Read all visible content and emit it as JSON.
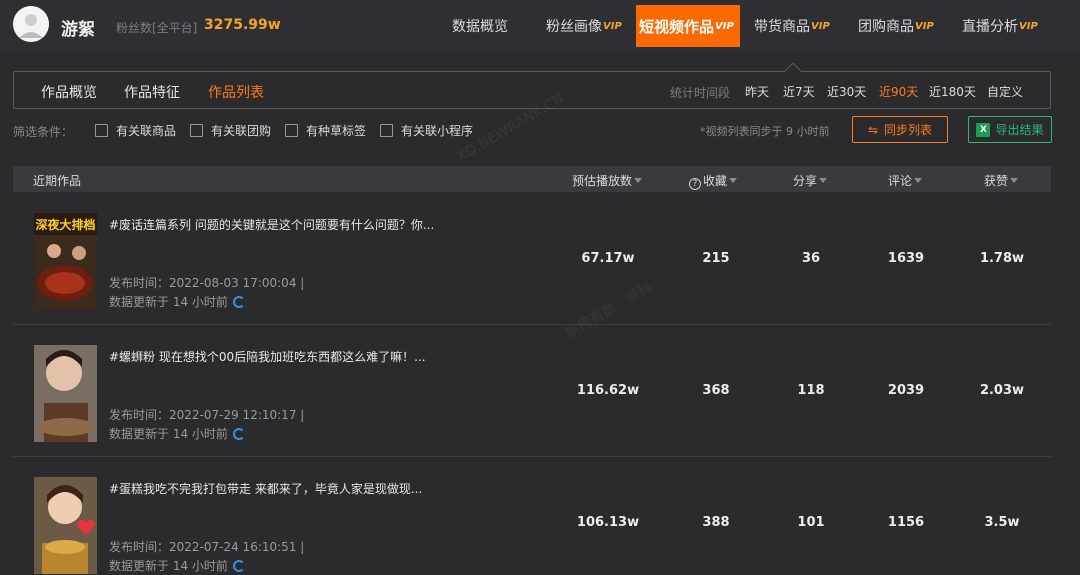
{
  "header": {
    "account_name": "游絮",
    "fans_label": "粉丝数[全平台]",
    "fans_value": "3275.99w",
    "nav": [
      {
        "label": "数据概览",
        "vip": ""
      },
      {
        "label": "粉丝画像",
        "vip": "VIP"
      },
      {
        "label": "短视频作品",
        "vip": "VIP"
      },
      {
        "label": "带货商品",
        "vip": "VIP"
      },
      {
        "label": "团购商品",
        "vip": "VIP"
      },
      {
        "label": "直播分析",
        "vip": "VIP"
      }
    ],
    "active_nav": 2
  },
  "subtabs": {
    "items": [
      "作品概览",
      "作品特征",
      "作品列表"
    ],
    "active": 2,
    "stat_label": "统计时间段",
    "periods": [
      "昨天",
      "近7天",
      "近30天",
      "近90天",
      "近180天",
      "自定义"
    ],
    "active_period": 3
  },
  "filters": {
    "label": "筛选条件：",
    "options": [
      "有关联商品",
      "有关联团购",
      "有种草标签",
      "有关联小程序"
    ],
    "sync_note": "*视频列表同步于 9 小时前",
    "sync_button": "同步列表",
    "export_button": "导出结果"
  },
  "table": {
    "columns": [
      "近期作品",
      "预估播放数",
      "收藏",
      "分享",
      "评论",
      "获赞"
    ],
    "rows": [
      {
        "thumb_text": "深夜大排档",
        "title": "#废话连篇系列 问题的关键就是这个问题要有什么问题？你...",
        "published": "发布时间：2022-08-03 17:00:04 |",
        "updated": "数据更新于 14 小时前",
        "plays": "67.17w",
        "favorites": "215",
        "shares": "36",
        "comments": "1639",
        "likes": "1.78w"
      },
      {
        "thumb_text": "",
        "title": "#螺蛳粉 现在想找个00后陪我加班吃东西都这么难了嘛！...",
        "published": "发布时间：2022-07-29 12:10:17 |",
        "updated": "数据更新于 14 小时前",
        "plays": "116.62w",
        "favorites": "368",
        "shares": "118",
        "comments": "2039",
        "likes": "2.03w"
      },
      {
        "thumb_text": "",
        "title": "#蛋糕我吃不完我打包带走 来都来了，毕竟人家是现做现...",
        "published": "发布时间：2022-07-24 16:10:51 |",
        "updated": "数据更新于 14 小时前",
        "plays": "106.13w",
        "favorites": "388",
        "shares": "101",
        "comments": "1156",
        "likes": "3.5w"
      }
    ]
  },
  "watermarks": [
    "XD.NEWRANK.CN",
    "新榜有数 · 新科"
  ],
  "colors": {
    "accent": "#ff6a00",
    "export_green": "#2eb872",
    "background": "#2b2b2e"
  }
}
